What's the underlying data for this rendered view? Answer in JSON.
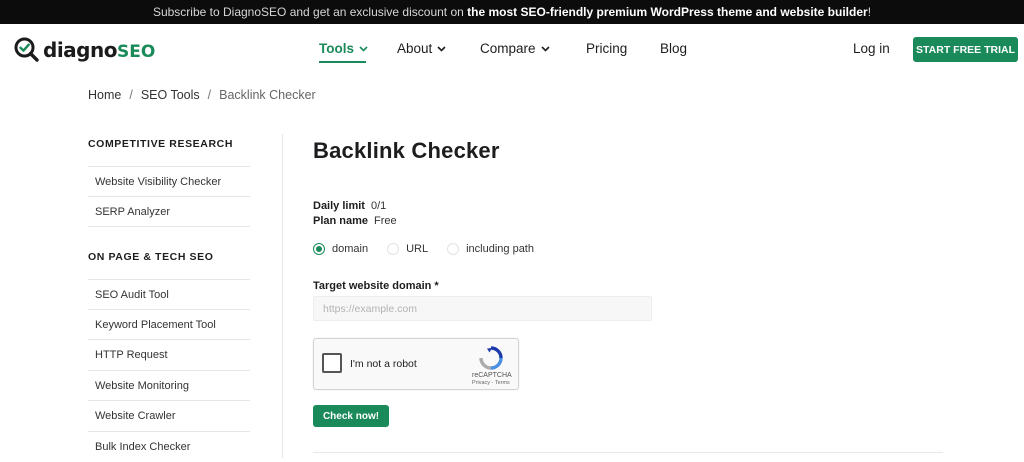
{
  "banner": {
    "prefix": "Subscribe to DiagnoSEO and get an exclusive discount on ",
    "highlight": "the most SEO-friendly premium WordPress theme and website builder",
    "suffix": "!"
  },
  "logo": {
    "word": "diagno",
    "seo": "SEO"
  },
  "nav": {
    "tools": "Tools",
    "about": "About",
    "compare": "Compare",
    "pricing": "Pricing",
    "blog": "Blog",
    "login": "Log in",
    "cta": "START FREE TRIAL"
  },
  "breadcrumb": {
    "home": "Home",
    "sep": "/",
    "tools": "SEO Tools",
    "current": "Backlink Checker"
  },
  "sidebar": {
    "heading1": "COMPETITIVE RESEARCH",
    "group1": [
      "Website Visibility Checker",
      "SERP Analyzer"
    ],
    "heading2": "ON PAGE & TECH SEO",
    "group2": [
      "SEO Audit Tool",
      "Keyword Placement Tool",
      "HTTP Request",
      "Website Monitoring",
      "Website Crawler",
      "Bulk Index Checker"
    ]
  },
  "main": {
    "title": "Backlink Checker",
    "daily_limit_label": "Daily limit",
    "daily_limit_value": "0/1",
    "plan_label": "Plan name",
    "plan_value": "Free",
    "radio_options": [
      "domain",
      "URL",
      "including path"
    ],
    "field_label": "Target website domain *",
    "placeholder": "https://example.com",
    "captcha_text": "I'm not a robot",
    "captcha_brand": "reCAPTCHA",
    "captcha_links": "Privacy - Terms",
    "check_button": "Check now!"
  },
  "colors": {
    "accent": "#1a8a5a",
    "banner_bg": "#0c0c0c"
  }
}
